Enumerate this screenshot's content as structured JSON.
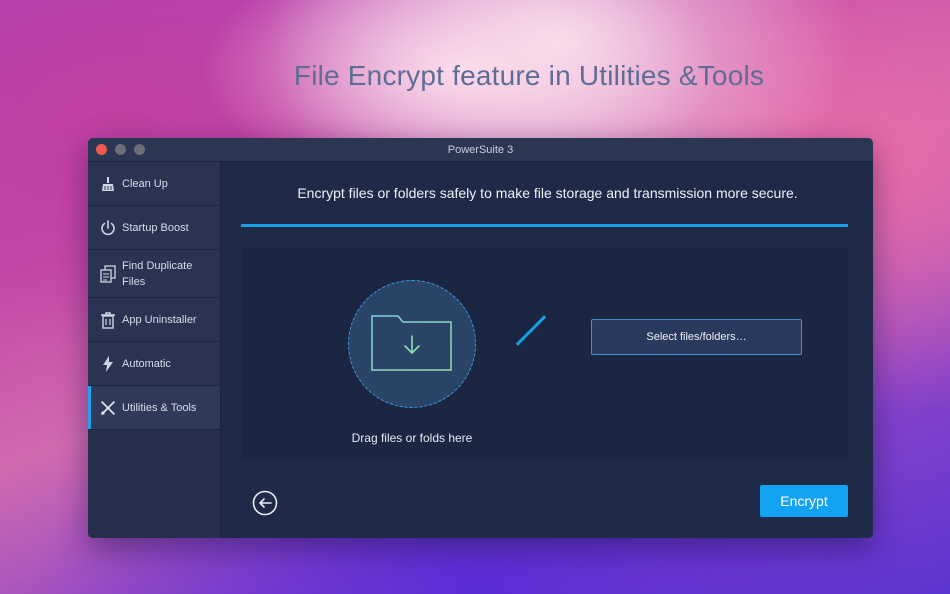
{
  "headline": "File Encrypt feature in Utilities &Tools",
  "window": {
    "title": "PowerSuite 3"
  },
  "sidebar": {
    "items": [
      {
        "label": "Clean Up",
        "icon": "broom-icon"
      },
      {
        "label": "Startup Boost",
        "icon": "power-icon"
      },
      {
        "label": "Find Duplicate Files",
        "icon": "duplicate-files-icon"
      },
      {
        "label": "App Uninstaller",
        "icon": "trash-icon"
      },
      {
        "label": "Automatic",
        "icon": "lightning-icon"
      },
      {
        "label": "Utilities & Tools",
        "icon": "tools-icon",
        "active": true
      }
    ]
  },
  "main": {
    "description": "Encrypt files or folders safely to make file storage and transmission more secure.",
    "drag_label": "Drag files or folds here",
    "select_button": "Select files/folders…",
    "encrypt_button": "Encrypt"
  },
  "colors": {
    "accent": "#14a2f2",
    "window_bg": "#1e2a47",
    "sidebar_bg": "#26304d"
  }
}
